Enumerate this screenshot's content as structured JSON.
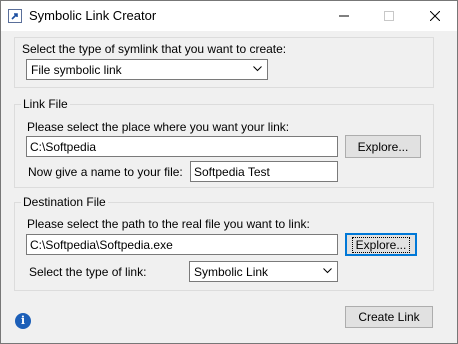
{
  "window": {
    "title": "Symbolic Link Creator"
  },
  "symlink_type": {
    "prompt": "Select the type of symlink that you want to create:",
    "selected": "File symbolic link"
  },
  "link_file": {
    "group_title": "Link File",
    "place_prompt": "Please select the place where you want your link:",
    "place_value": "C:\\Softpedia",
    "explore_label": "Explore...",
    "name_prompt": "Now give a name to your file:",
    "name_value": "Softpedia Test"
  },
  "destination_file": {
    "group_title": "Destination File",
    "path_prompt": "Please select the path to the real file you want to link:",
    "path_value": "C:\\Softpedia\\Softpedia.exe",
    "explore_label": "Explore...",
    "type_prompt": "Select the type of link:",
    "type_selected": "Symbolic Link"
  },
  "actions": {
    "create_label": "Create Link"
  },
  "icons": {
    "app": "app-icon",
    "info": "info-icon"
  }
}
